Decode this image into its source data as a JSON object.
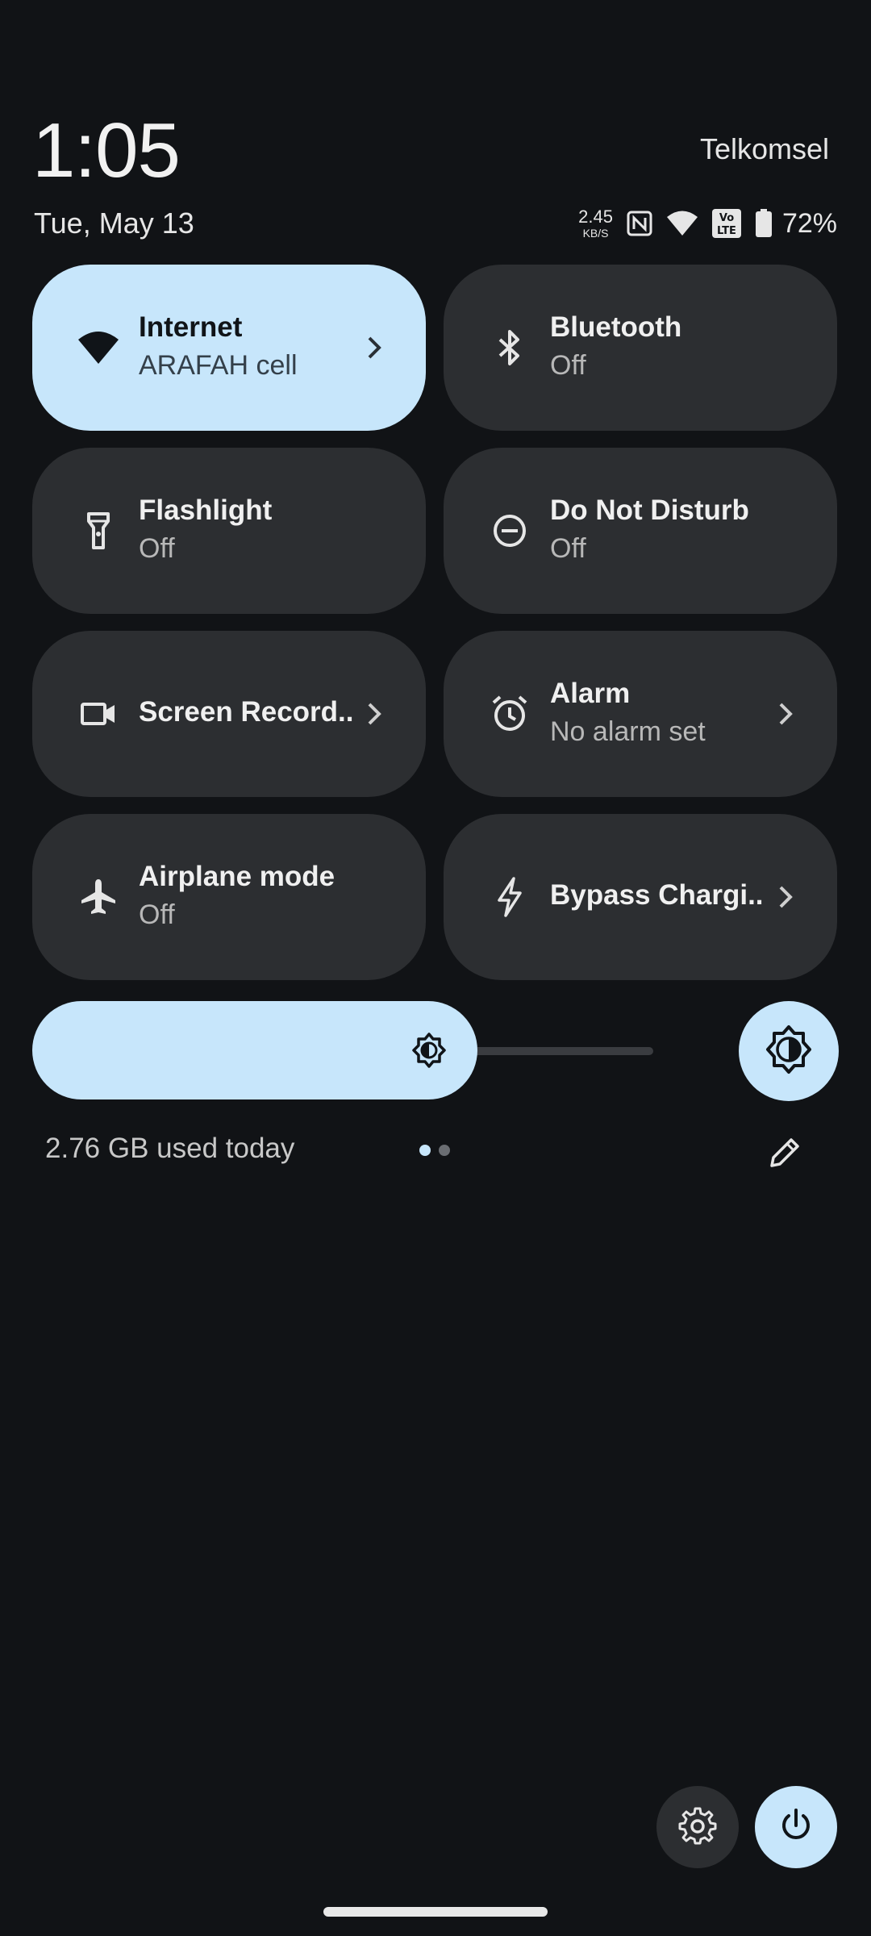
{
  "header": {
    "time": "1:05",
    "carrier": "Telkomsel",
    "date": "Tue, May 13"
  },
  "status_bar": {
    "net_speed_value": "2.45",
    "net_speed_unit": "KB/S",
    "battery_percent": "72%",
    "icons": [
      "nfc-icon",
      "wifi-icon",
      "volte-icon",
      "battery-icon"
    ]
  },
  "tiles": [
    {
      "label": "Internet",
      "subtitle": "ARAFAH cell",
      "icon": "wifi-icon",
      "active": true,
      "chevron": true
    },
    {
      "label": "Bluetooth",
      "subtitle": "Off",
      "icon": "bluetooth-icon",
      "active": false,
      "chevron": false
    },
    {
      "label": "Flashlight",
      "subtitle": "Off",
      "icon": "flashlight-icon",
      "active": false,
      "chevron": false
    },
    {
      "label": "Do Not Disturb",
      "subtitle": "Off",
      "icon": "do-not-disturb-icon",
      "active": false,
      "chevron": false
    },
    {
      "label": "Screen Record..",
      "subtitle": "",
      "icon": "videocam-icon",
      "active": false,
      "chevron": true
    },
    {
      "label": "Alarm",
      "subtitle": "No alarm set",
      "icon": "alarm-icon",
      "active": false,
      "chevron": true
    },
    {
      "label": "Airplane mode",
      "subtitle": "Off",
      "icon": "airplane-icon",
      "active": false,
      "chevron": false
    },
    {
      "label": "Bypass Chargi..",
      "subtitle": "",
      "icon": "bolt-icon",
      "active": false,
      "chevron": true
    }
  ],
  "brightness": {
    "level": 0.56,
    "icon": "brightness-icon",
    "auto_icon": "auto-brightness-icon"
  },
  "footer": {
    "data_usage": "2.76 GB used today",
    "page_count": 2,
    "current_page": 1
  },
  "colors": {
    "background": "#111316",
    "tile": "#2c2e31",
    "accent": "#c7e6fb"
  }
}
